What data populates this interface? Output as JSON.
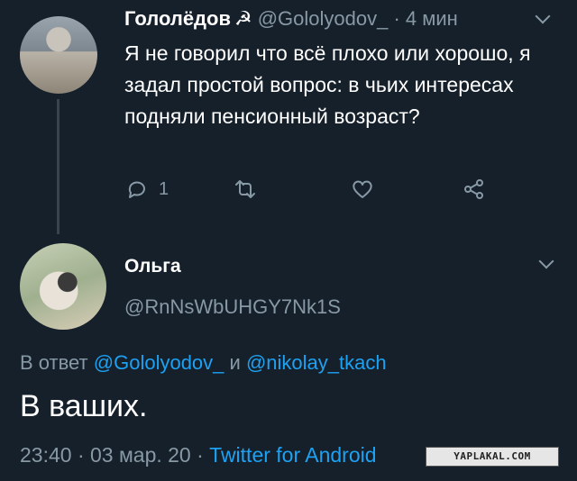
{
  "tweet1": {
    "name": "Гололёдов",
    "symbol": "☭",
    "handle": "@Gololyodov_",
    "time": "· 4 мин",
    "text": "Я не говорил что всё плохо или хорошо, я задал простой вопрос: в чьих интересах подняли пенсионный возраст?",
    "reply_count": "1"
  },
  "tweet2": {
    "name": "Ольга",
    "handle": "@RnNsWbUHGY7Nk1S",
    "reply_prefix": "В ответ",
    "reply_user1": "@Gololyodov_",
    "reply_and": "и",
    "reply_user2": "@nikolay_tkach",
    "text": "В ваших.",
    "timestamp": "23:40 · 03 мар. 20 ·",
    "source": "Twitter for Android"
  },
  "watermark": "YAPLAKAL.COM",
  "colors": {
    "background": "#15202b",
    "muted": "#8899a6",
    "link": "#1da1f2"
  }
}
